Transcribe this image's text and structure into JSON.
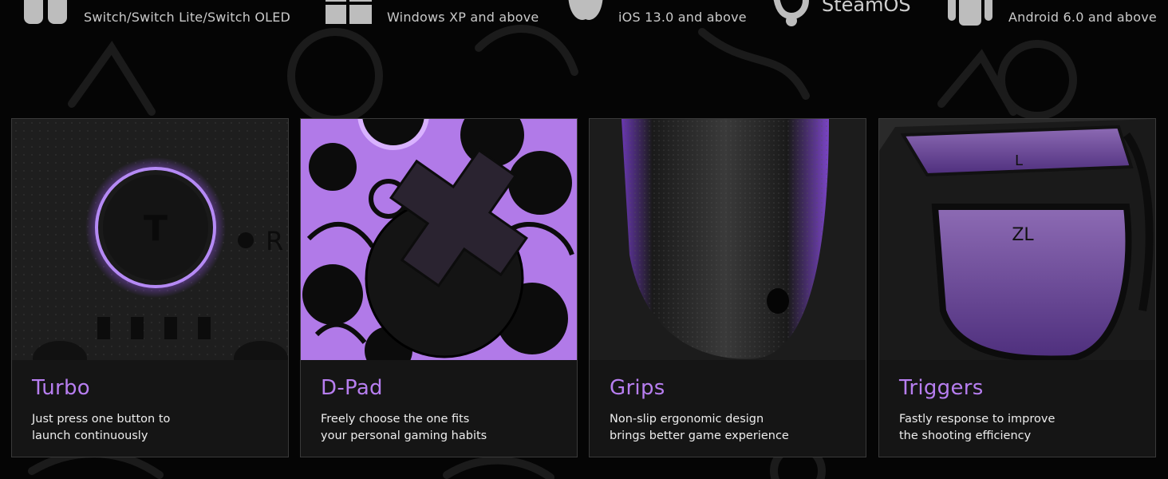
{
  "platforms": [
    {
      "icon": "switch-icon",
      "label": "Switch/Switch Lite/Switch OLED"
    },
    {
      "icon": "windows-icon",
      "label": "Windows XP and above"
    },
    {
      "icon": "apple-icon",
      "label": "iOS 13.0 and above"
    },
    {
      "icon": "steam-icon",
      "label": "SteamOS"
    },
    {
      "icon": "android-icon",
      "label": "Android 6.0 and above"
    }
  ],
  "features": [
    {
      "title": "Turbo",
      "line1": "Just press one button to",
      "line2": "launch continuously"
    },
    {
      "title": "D-Pad",
      "line1": "Freely choose the one fits",
      "line2": "your personal gaming habits"
    },
    {
      "title": "Grips",
      "line1": "Non-slip ergonomic design",
      "line2": "brings better game experience"
    },
    {
      "title": "Triggers",
      "line1": "Fastly response to improve",
      "line2": "the shooting efficiency"
    }
  ],
  "turbo_photo": {
    "key_glyph": "T",
    "side_label": "R"
  },
  "triggers_photo": {
    "upper_glyph": "L",
    "lower_glyph": "ZL"
  },
  "colors": {
    "accent": "#b77ef0",
    "background": "#050505",
    "card": "#151515"
  }
}
